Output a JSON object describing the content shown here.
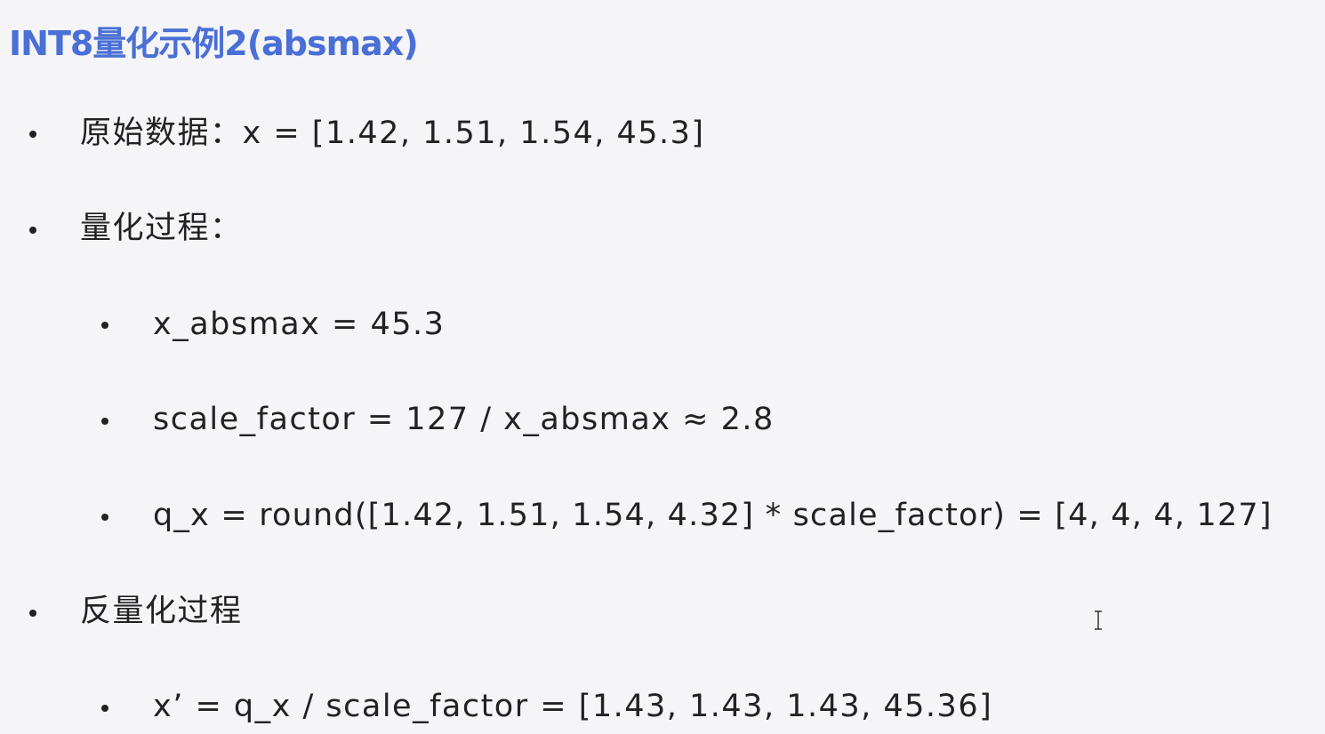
{
  "slide": {
    "title": "INT8量化示例2(absmax)",
    "items": [
      {
        "level": 1,
        "text": "原始数据：x = [1.42, 1.51, 1.54, 45.3]"
      },
      {
        "level": 1,
        "text": "量化过程："
      },
      {
        "level": 2,
        "text": "x_absmax = 45.3"
      },
      {
        "level": 2,
        "text": "scale_factor = 127 / x_absmax ≈ 2.8"
      },
      {
        "level": 2,
        "text": "q_x = round([1.42, 1.51, 1.54, 4.32] * scale_factor) = [4, 4, 4, 127]"
      },
      {
        "level": 1,
        "text": "反量化过程"
      },
      {
        "level": 2,
        "text": "x’ = q_x / scale_factor = [1.43, 1.43, 1.43, 45.36]"
      }
    ]
  },
  "cursor": {
    "icon": "text-cursor-icon"
  }
}
